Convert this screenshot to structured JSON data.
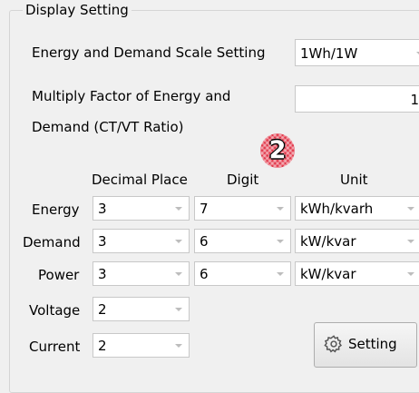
{
  "group_title": "Display Setting",
  "scale": {
    "label": "Energy and Demand Scale Setting",
    "value": "1Wh/1W"
  },
  "multiply": {
    "label_line1": "Multiply Factor of Energy and",
    "label_line2": "Demand (CT/VT Ratio)",
    "value": "1"
  },
  "badge": "2",
  "headers": {
    "decimal_place": "Decimal Place",
    "digit": "Digit",
    "unit": "Unit"
  },
  "rows": [
    {
      "label": "Energy",
      "decimal": "3",
      "digit": "7",
      "unit": "kWh/kvarh"
    },
    {
      "label": "Demand",
      "decimal": "3",
      "digit": "6",
      "unit": "kW/kvar"
    },
    {
      "label": "Power",
      "decimal": "3",
      "digit": "6",
      "unit": "kW/kvar"
    },
    {
      "label": "Voltage",
      "decimal": "2"
    },
    {
      "label": "Current",
      "decimal": "2"
    }
  ],
  "setting_button": {
    "label": "Setting",
    "icon": "gear-icon"
  }
}
